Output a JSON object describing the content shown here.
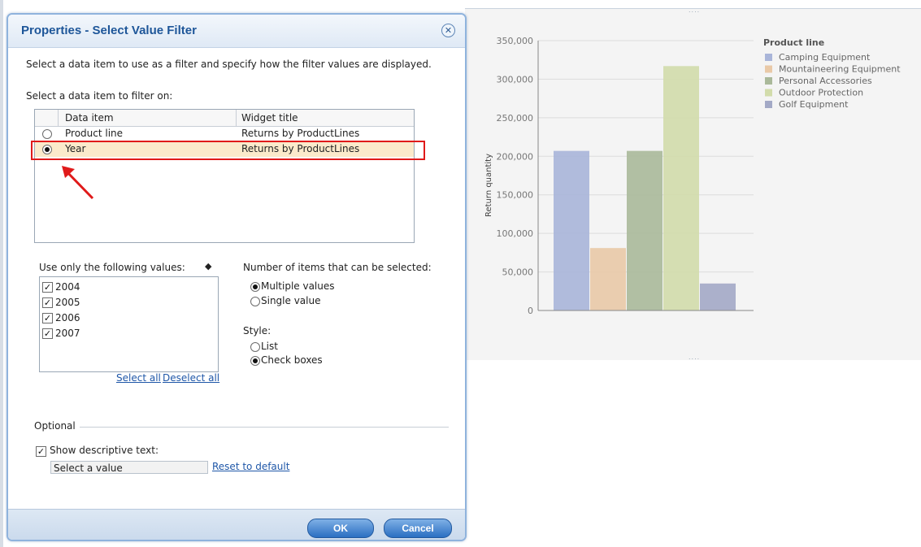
{
  "dialog": {
    "title": "Properties - Select Value Filter",
    "close_icon": "close-icon",
    "intro": "Select a data item to use as a filter and specify how the filter values are displayed.",
    "select_label": "Select a data item to filter on:",
    "columns": [
      "Data item",
      "Widget title"
    ],
    "rows": [
      {
        "item": "Product line",
        "title": "Returns by ProductLines",
        "selected": false
      },
      {
        "item": "Year",
        "title": "Returns by ProductLines",
        "selected": true
      }
    ],
    "use_only_label": "Use only the following values:",
    "values": [
      {
        "label": "2004",
        "checked": true
      },
      {
        "label": "2005",
        "checked": true
      },
      {
        "label": "2006",
        "checked": true
      },
      {
        "label": "2007",
        "checked": true
      }
    ],
    "select_all": "Select all",
    "deselect_all": "Deselect all",
    "number_label": "Number of items that can be selected:",
    "multiple": "Multiple values",
    "single": "Single value",
    "number_selected": "Multiple values",
    "style_label": "Style:",
    "style_list": "List",
    "style_check": "Check boxes",
    "style_selected": "Check boxes",
    "optional_label": "Optional",
    "show_desc_label": "Show descriptive text:",
    "show_desc_checked": true,
    "desc_value": "Select a value",
    "reset_link": "Reset to default",
    "ok": "OK",
    "cancel": "Cancel"
  },
  "annotation": {
    "color": "#e01a1a"
  },
  "chart_data": {
    "type": "bar",
    "title": "",
    "xlabel": "",
    "ylabel": "Return quantity",
    "ylim": [
      0,
      350000
    ],
    "ticks": [
      0,
      50000,
      100000,
      150000,
      200000,
      250000,
      300000,
      350000
    ],
    "tick_labels": [
      "0",
      "50,000",
      "100,000",
      "150,000",
      "200,000",
      "250,000",
      "300,000",
      "350,000"
    ],
    "legend_title": "Product line",
    "legend_position": "top-right",
    "grid": true,
    "categories": [
      "Camping Equipment",
      "Mountaineering Equipment",
      "Personal Accessories",
      "Outdoor Protection",
      "Golf Equipment"
    ],
    "series": [
      {
        "name": "Camping Equipment",
        "values": [
          207000
        ],
        "color": "#a9b5d9"
      },
      {
        "name": "Mountaineering Equipment",
        "values": [
          81000
        ],
        "color": "#e9c9a7"
      },
      {
        "name": "Personal Accessories",
        "values": [
          207000
        ],
        "color": "#aab99a"
      },
      {
        "name": "Outdoor Protection",
        "values": [
          317000
        ],
        "color": "#d2dcab"
      },
      {
        "name": "Golf Equipment",
        "values": [
          35000
        ],
        "color": "#a3a9c6"
      }
    ]
  }
}
